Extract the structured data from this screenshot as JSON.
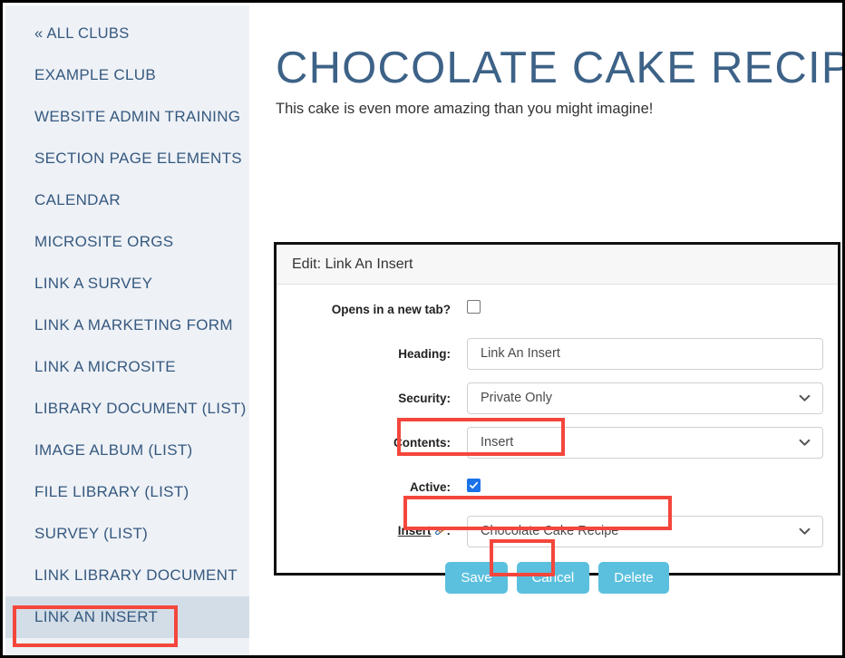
{
  "sidebar": {
    "items": [
      {
        "label": "« ALL CLUBS",
        "active": false
      },
      {
        "label": "EXAMPLE CLUB",
        "active": false
      },
      {
        "label": "WEBSITE ADMIN TRAINING",
        "active": false
      },
      {
        "label": "SECTION PAGE ELEMENTS",
        "active": false
      },
      {
        "label": "CALENDAR",
        "active": false
      },
      {
        "label": "MICROSITE ORGS",
        "active": false
      },
      {
        "label": "LINK A SURVEY",
        "active": false
      },
      {
        "label": "LINK A MARKETING FORM",
        "active": false
      },
      {
        "label": "LINK A MICROSITE",
        "active": false
      },
      {
        "label": "LIBRARY DOCUMENT (LIST)",
        "active": false
      },
      {
        "label": "IMAGE ALBUM (LIST)",
        "active": false
      },
      {
        "label": "FILE LIBRARY (LIST)",
        "active": false
      },
      {
        "label": "SURVEY (LIST)",
        "active": false
      },
      {
        "label": "LINK LIBRARY DOCUMENT",
        "active": false
      },
      {
        "label": "LINK AN INSERT",
        "active": true
      }
    ]
  },
  "main": {
    "title": "CHOCOLATE CAKE RECIPE",
    "subtitle": "This cake is even more amazing than you might imagine!"
  },
  "panel": {
    "header_title": "Edit: Link An Insert",
    "fields": {
      "new_tab_label": "Opens in a new tab?",
      "new_tab_checked": false,
      "heading_label": "Heading:",
      "heading_value": "Link An Insert",
      "heading_placeholder": "Link An Insert",
      "security_label": "Security:",
      "security_value": "Private Only",
      "contents_label": "Contents:",
      "contents_value": "Insert",
      "active_label": "Active:",
      "active_checked": true,
      "insert_label": "Insert",
      "insert_label_suffix": ":",
      "insert_value": "Chocolate Cake Recipe"
    },
    "buttons": {
      "save": "Save",
      "cancel": "Cancel",
      "delete": "Delete"
    }
  },
  "colors": {
    "accent_button": "#5bc0de",
    "highlight": "#f4463c",
    "sidebar_bg": "#eef1f6",
    "sidebar_active_bg": "#d3dde7",
    "title_blue": "#3d6287",
    "checkbox_blue": "#1a73e8"
  },
  "icons": {
    "chevron_down": "chevron-down-icon",
    "chain_link": "chain-link-icon",
    "checkmark": "checkmark-icon"
  }
}
